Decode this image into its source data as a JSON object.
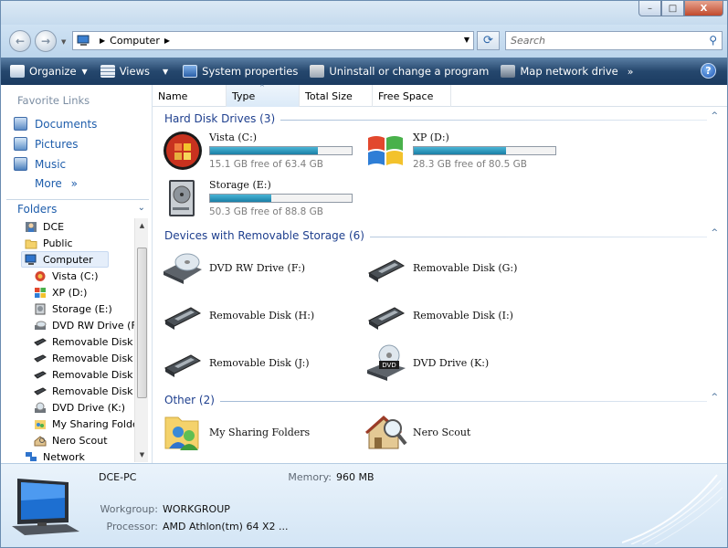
{
  "window": {
    "title": "",
    "minimize_glyph": "–",
    "maximize_glyph": "□",
    "close_glyph": "X"
  },
  "address_bar": {
    "back_glyph": "←",
    "forward_glyph": "→",
    "path_root_arrow": "▶",
    "location": "Computer",
    "path_arrow": "▶",
    "dropdown_glyph": "▼",
    "refresh_glyph": "⟳",
    "search_placeholder": "Search",
    "search_glyph": "⚲"
  },
  "toolbar": {
    "organize": "Organize",
    "views": "Views",
    "system_properties": "System properties",
    "uninstall": "Uninstall or change a program",
    "map_drive": "Map network drive",
    "overflow": "»",
    "help": "?"
  },
  "nav": {
    "favorite_links_title": "Favorite Links",
    "favorites": [
      "Documents",
      "Pictures",
      "Music"
    ],
    "more": "More",
    "more_glyph": "»",
    "folders_label": "Folders",
    "folders_chevron": "⌄",
    "tree": [
      {
        "label": "DCE",
        "icon": "user-folder-icon"
      },
      {
        "label": "Public",
        "icon": "folder-icon"
      },
      {
        "label": "Computer",
        "icon": "computer-icon"
      },
      {
        "label": "Vista (C:)",
        "icon": "vista-drive-icon"
      },
      {
        "label": "XP (D:)",
        "icon": "xp-drive-icon"
      },
      {
        "label": "Storage (E:)",
        "icon": "hard-drive-icon"
      },
      {
        "label": "DVD RW Drive (F",
        "icon": "dvd-rw-icon"
      },
      {
        "label": "Removable Disk (",
        "icon": "removable-disk-icon"
      },
      {
        "label": "Removable Disk (",
        "icon": "removable-disk-icon"
      },
      {
        "label": "Removable Disk (",
        "icon": "removable-disk-icon"
      },
      {
        "label": "Removable Disk (",
        "icon": "removable-disk-icon"
      },
      {
        "label": "DVD Drive (K:)",
        "icon": "dvd-drive-icon"
      },
      {
        "label": "My Sharing Folde",
        "icon": "sharing-folders-icon"
      },
      {
        "label": "Nero Scout",
        "icon": "nero-scout-icon"
      },
      {
        "label": "Network",
        "icon": "network-icon"
      }
    ],
    "scroll_up": "▲",
    "scroll_down": "▼"
  },
  "columns": [
    "Name",
    "Type",
    "Total Size",
    "Free Space"
  ],
  "sort_caret": "^",
  "groups": {
    "hard_disks": "Hard Disk Drives (3)",
    "removable": "Devices with Removable Storage (6)",
    "other": "Other (2)",
    "collapse_glyph": "^"
  },
  "hard_disks": [
    {
      "name": "Vista (C:)",
      "free_text": "15.1 GB free of 63.4 GB",
      "used_fraction": 0.76
    },
    {
      "name": "XP (D:)",
      "free_text": "28.3 GB free of 80.5 GB",
      "used_fraction": 0.65
    },
    {
      "name": "Storage (E:)",
      "free_text": "50.3 GB free of 88.8 GB",
      "used_fraction": 0.43
    }
  ],
  "removable": [
    "DVD RW Drive (F:)",
    "Removable Disk (G:)",
    "Removable Disk (H:)",
    "Removable Disk (I:)",
    "Removable Disk (J:)",
    "DVD Drive (K:)"
  ],
  "other": [
    "My Sharing Folders",
    "Nero Scout"
  ],
  "details": {
    "computer_name": "DCE-PC",
    "memory_label": "Memory:",
    "memory_value": "960 MB",
    "workgroup_label": "Workgroup:",
    "workgroup_value": "WORKGROUP",
    "processor_label": "Processor:",
    "processor_value": "AMD Athlon(tm) 64 X2 ..."
  },
  "colors": {
    "toolbar": "#25476d",
    "link": "#1e5dab",
    "group_header": "#1e3f8e",
    "bar_fill": "#1a7fa6"
  }
}
